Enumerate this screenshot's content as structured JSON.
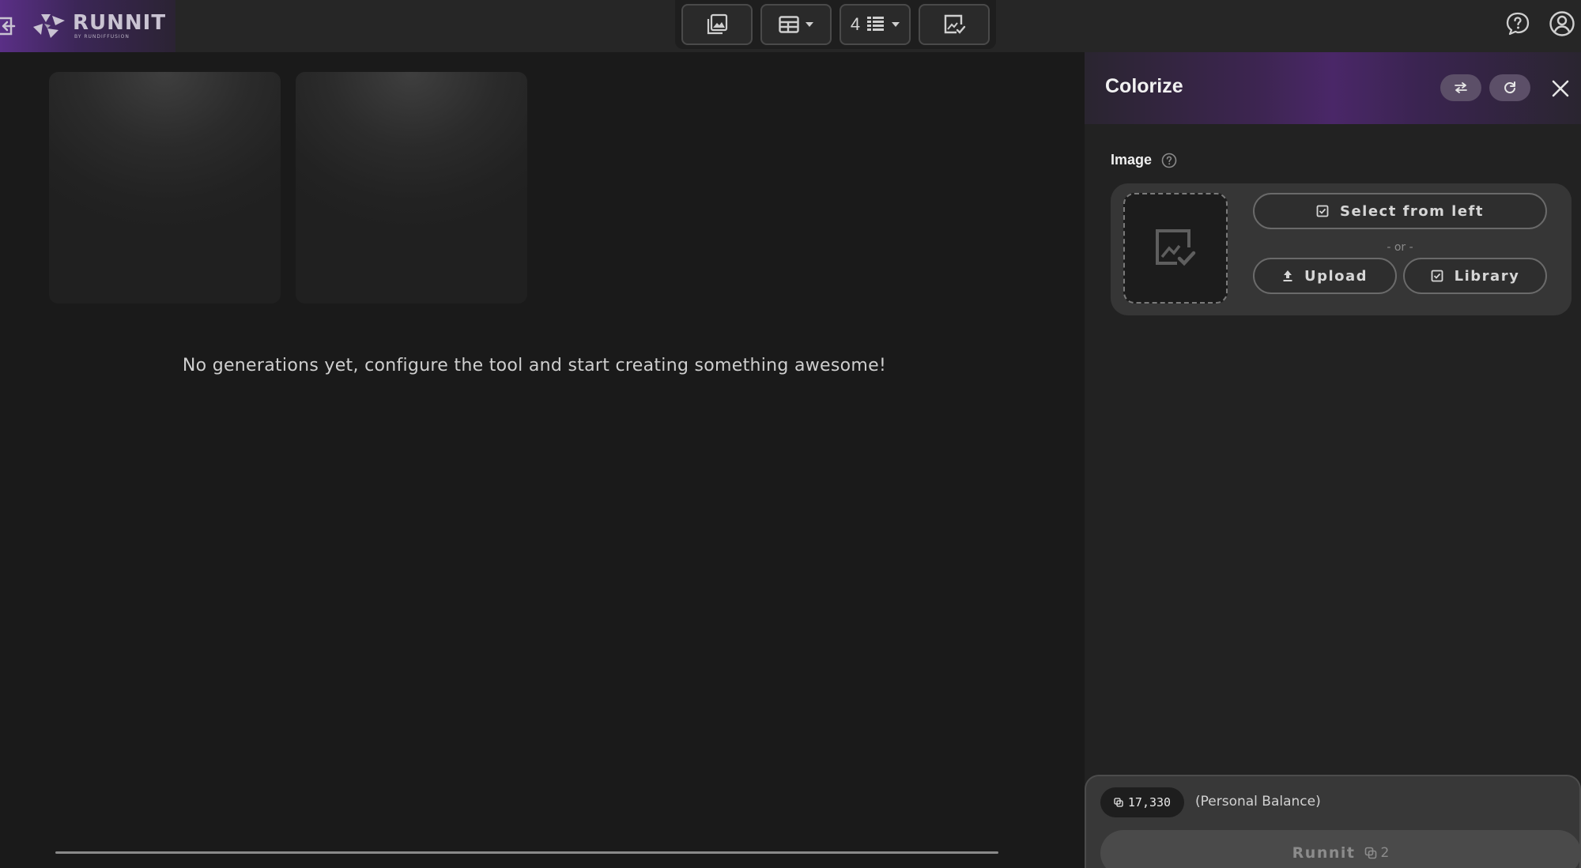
{
  "brand": {
    "name": "RUNNIT",
    "tagline": "BY RUNDIFFUSION"
  },
  "toolbar": {
    "columns_value": "4"
  },
  "main": {
    "empty_message": "No generations yet, configure the tool and start creating something awesome!"
  },
  "panel": {
    "title": "Colorize",
    "image_label": "Image",
    "select_from_left": "Select from left",
    "or_text": "- or -",
    "upload": "Upload",
    "library": "Library",
    "balance": "17,330",
    "balance_note": "(Personal Balance)",
    "run_button": "Runnit",
    "run_cost": "2"
  },
  "colors": {
    "background": "#1a1a1a",
    "accent_purple": "#4a2768",
    "panel": "#222222"
  }
}
